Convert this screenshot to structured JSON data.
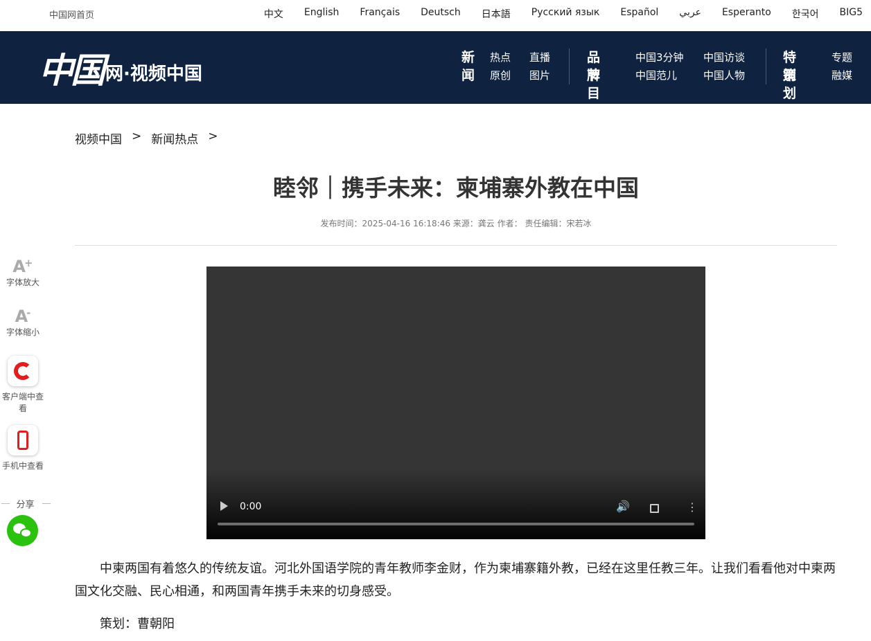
{
  "topbar": {
    "home": "中国网首页",
    "languages": [
      "中文",
      "English",
      "Français",
      "Deutsch",
      "日本語",
      "Русский язык",
      "Español",
      "عربي",
      "Esperanto",
      "한국어",
      "BIG5"
    ]
  },
  "header": {
    "logo_mark": "中国",
    "logo_text": "网·视频中国",
    "groups": [
      {
        "title_line1": "新",
        "title_line2": "闻",
        "items": [
          "热点",
          "直播",
          "原创",
          "图片"
        ]
      },
      {
        "title_line1": "品牌",
        "title_line2": "节目",
        "items": [
          "中国3分钟",
          "中国访谈",
          "中国范儿",
          "中国人物"
        ]
      },
      {
        "title_line1": "特别",
        "title_line2": "策划",
        "items": [
          "专题",
          "融媒"
        ]
      }
    ]
  },
  "breadcrumb": {
    "items": [
      "视频中国",
      "新闻热点"
    ],
    "separator": ">"
  },
  "article": {
    "title": "睦邻｜携手未来：柬埔寨外教在中国",
    "meta": "发布时间：2025-04-16 16:18:46 来源：龚云 作者： 责任编辑：宋若冰",
    "paragraphs": [
      "中柬两国有着悠久的传统友谊。河北外国语学院的青年教师李金财，作为柬埔寨籍外教，已经在这里任教三年。让我们看看他对中柬两国文化交融、民心相通，和两国青年携手未来的切身感受。",
      "策划：曹朝阳"
    ]
  },
  "video": {
    "time": "0:00",
    "progress": 0
  },
  "sidebar": {
    "font_bigger": "字体放大",
    "font_smaller": "字体缩小",
    "client_view": "客户端中查看",
    "mobile_view": "手机中查看",
    "share": "分享"
  },
  "colors": {
    "header_bg": "#0f2240",
    "accent_red": "#e21d1d",
    "wechat_green": "#2bc20f"
  }
}
